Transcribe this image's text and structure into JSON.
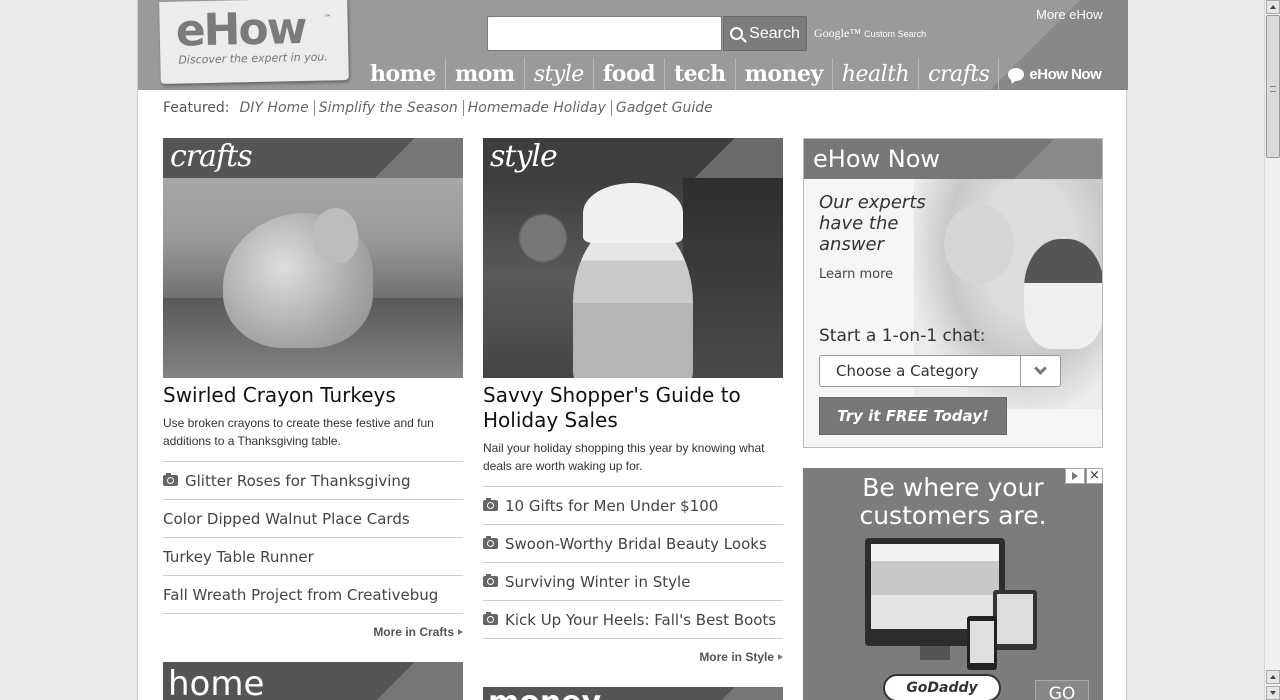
{
  "header": {
    "logo_word": "eHow",
    "logo_tm": "™",
    "tagline": "Discover the expert in you.",
    "search_placeholder": "",
    "search_label": "Search",
    "google_brand": "Google™",
    "google_custom": "Custom Search",
    "more_ehow": "More eHow",
    "nav": [
      "home",
      "mom",
      "style",
      "food",
      "tech",
      "money",
      "health",
      "crafts",
      "eHow Now"
    ]
  },
  "featured": {
    "label": "Featured:",
    "links": [
      "DIY Home",
      "Simplify the Season",
      "Homemade Holiday",
      "Gadget Guide"
    ]
  },
  "crafts": {
    "banner": "crafts",
    "title": "Swirled Crayon Turkeys",
    "desc": "Use broken crayons to create these festive and fun additions to a Thanksgiving table.",
    "items": [
      {
        "text": "Glitter Roses for Thanksgiving",
        "photo": true
      },
      {
        "text": "Color Dipped Walnut Place Cards",
        "photo": false
      },
      {
        "text": "Turkey Table Runner",
        "photo": false
      },
      {
        "text": "Fall Wreath Project from Creativebug",
        "photo": false
      }
    ],
    "more": "More in Crafts"
  },
  "style": {
    "banner": "style",
    "title": "Savvy Shopper's Guide to Holiday Sales",
    "desc": "Nail your holiday shopping this year by knowing what deals are worth waking up for.",
    "items": [
      {
        "text": "10 Gifts for Men Under $100",
        "photo": true
      },
      {
        "text": "Swoon-Worthy Bridal Beauty Looks",
        "photo": true
      },
      {
        "text": "Surviving Winter in Style",
        "photo": true
      },
      {
        "text": "Kick Up Your Heels: Fall's Best Boots",
        "photo": true
      }
    ],
    "more": "More in Style"
  },
  "ehow_now": {
    "banner": "eHow Now",
    "tagline": "Our experts have the answer",
    "learn_more": "Learn more",
    "chat_label": "Start a 1-on-1 chat:",
    "category_select": "Choose a Category",
    "cta": "Try it FREE Today!"
  },
  "ad": {
    "headline": "Be where your customers are.",
    "brand": "GoDaddy",
    "go": "GO"
  },
  "teasers": {
    "home": "home",
    "money": "money"
  },
  "icons": {
    "search": "search-icon",
    "photo": "camera-icon",
    "chat": "chat-bubble-icon",
    "chevron": "chevron-down-icon"
  }
}
